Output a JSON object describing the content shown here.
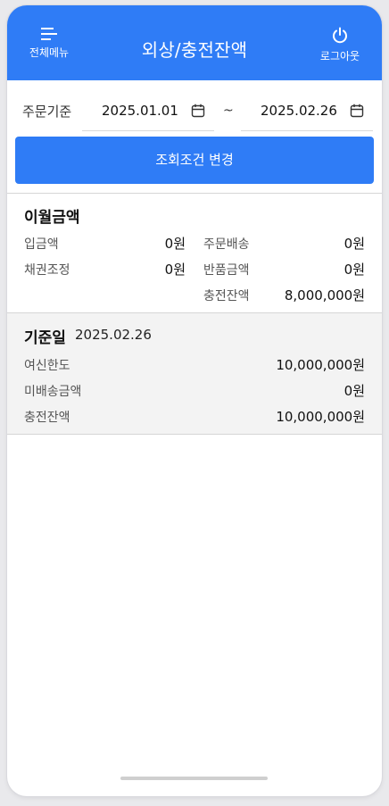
{
  "header": {
    "menu_label": "전체메뉴",
    "title": "외상/충전잔액",
    "logout_label": "로그아웃",
    "background": "#2f7cf6"
  },
  "filter": {
    "label": "주문기준",
    "start_date": "2025.01.01",
    "separator": "~",
    "end_date": "2025.02.26",
    "search_button": "조회조건 변경"
  },
  "carryover": {
    "title": "이월금액",
    "left_rows": [
      {
        "label": "입금액",
        "value": "0원"
      },
      {
        "label": "채권조정",
        "value": "0원"
      }
    ],
    "right_rows": [
      {
        "label": "주문배송",
        "value": "0원"
      },
      {
        "label": "반품금액",
        "value": "0원"
      },
      {
        "label": "충전잔액",
        "value": "8,000,000원"
      }
    ]
  },
  "base": {
    "title": "기준일",
    "date": "2025.02.26",
    "rows": [
      {
        "label": "여신한도",
        "value": "10,000,000원"
      },
      {
        "label": "미배송금액",
        "value": "0원"
      },
      {
        "label": "충전잔액",
        "value": "10,000,000원"
      }
    ]
  }
}
